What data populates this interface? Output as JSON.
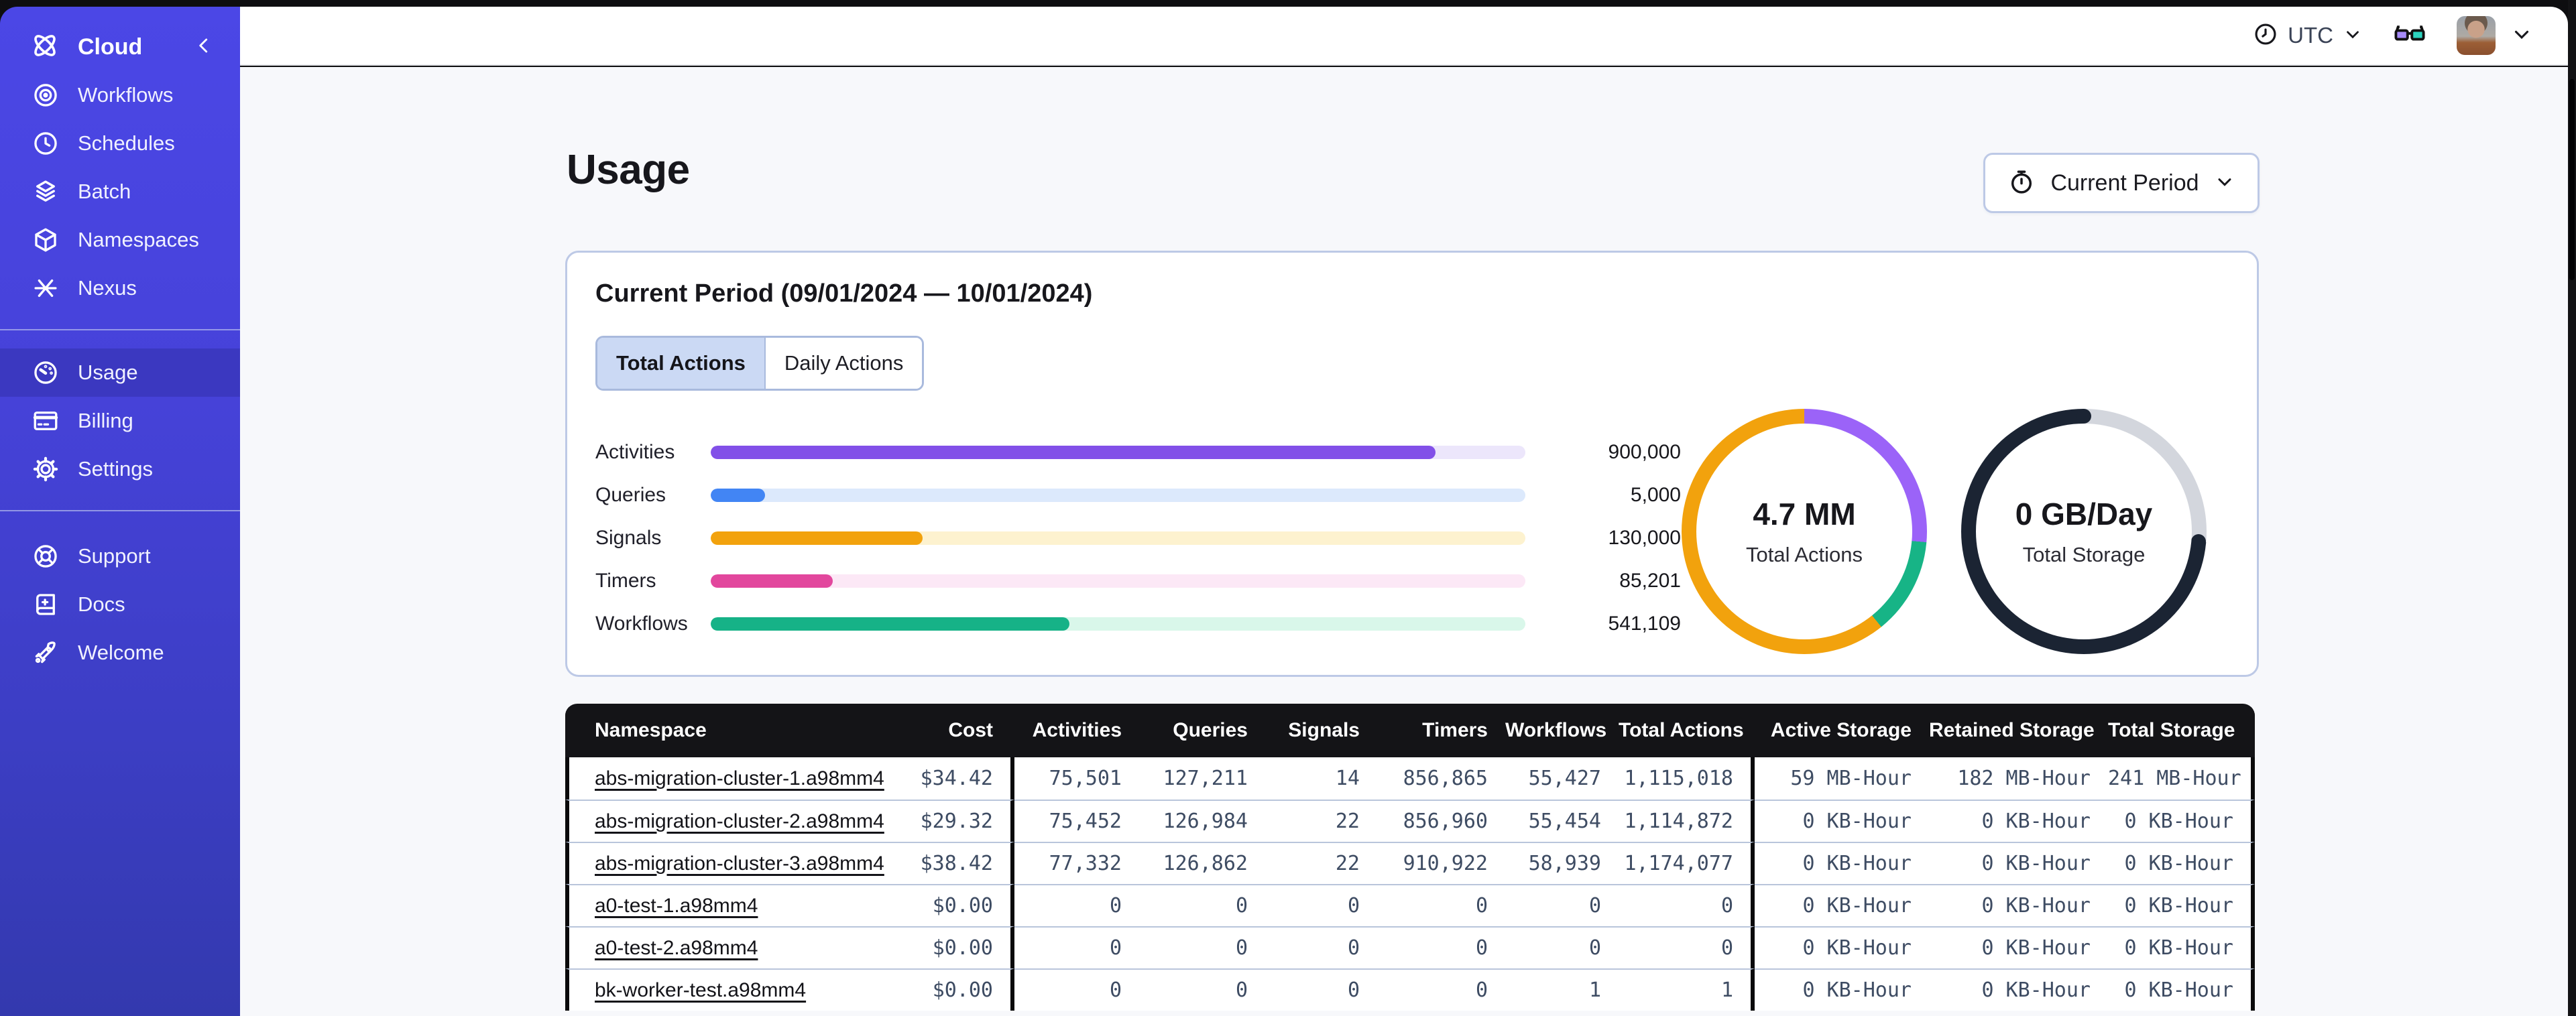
{
  "theme": {
    "sidebar_top": "#4b47e6",
    "sidebar_bottom": "#3339ae",
    "sidebar_active": "#3b38c0",
    "table_header_bg": "#141417",
    "card_border": "#bdc9e6",
    "content_bg": "#f7f8fb",
    "mono_text": "#3e4c63"
  },
  "sidebar": {
    "brand": {
      "label": "Cloud"
    },
    "groups": [
      {
        "items": [
          {
            "label": "Workflows"
          },
          {
            "label": "Schedules"
          },
          {
            "label": "Batch"
          },
          {
            "label": "Namespaces"
          },
          {
            "label": "Nexus"
          }
        ]
      },
      {
        "items": [
          {
            "label": "Usage",
            "active": true
          },
          {
            "label": "Billing"
          },
          {
            "label": "Settings"
          }
        ]
      },
      {
        "items": [
          {
            "label": "Support"
          },
          {
            "label": "Docs"
          },
          {
            "label": "Welcome"
          }
        ]
      }
    ]
  },
  "topbar": {
    "timezone": {
      "label": "UTC"
    }
  },
  "page": {
    "title": "Usage",
    "period_button": {
      "label": "Current Period"
    }
  },
  "usage_card": {
    "title": "Current Period (09/01/2024 — 10/01/2024)",
    "tabs": [
      {
        "label": "Total Actions",
        "active": true
      },
      {
        "label": "Daily Actions",
        "active": false
      }
    ]
  },
  "chart_data": [
    {
      "type": "bar",
      "orientation": "horizontal",
      "categories": [
        "Activities",
        "Queries",
        "Signals",
        "Timers",
        "Workflows"
      ],
      "values": [
        900000,
        5000,
        130000,
        85201,
        541109
      ],
      "value_labels": [
        "900,000",
        "5,000",
        "130,000",
        "85,201",
        "541,109"
      ],
      "fill_pct": [
        89,
        6.7,
        26,
        15,
        44
      ],
      "colors": [
        "#8250e8",
        "#4285f4",
        "#f2a20d",
        "#e2479d",
        "#16b287"
      ],
      "track_colors": [
        "#ece6fb",
        "#dce9fc",
        "#fdf2cf",
        "#fce8f6",
        "#d9f7ea"
      ]
    },
    {
      "type": "donut",
      "center_value": "4.7 MM",
      "center_label": "Total Actions",
      "segments": [
        {
          "color": "#9b63f8",
          "pct": 26.4
        },
        {
          "color": "#17b486",
          "pct": 12.8
        },
        {
          "color": "#f2a20d",
          "pct": 60.8
        }
      ]
    },
    {
      "type": "donut",
      "center_value": "0 GB/Day",
      "center_label": "Total Storage",
      "segments": [
        {
          "color": "#d3d6dd",
          "pct": 26.4
        },
        {
          "color": "#1b2433",
          "pct": 73.6
        }
      ]
    }
  ],
  "table": {
    "columns": [
      "Namespace",
      "Cost",
      "Activities",
      "Queries",
      "Signals",
      "Timers",
      "Workflows",
      "Total Actions",
      "Active Storage",
      "Retained Storage",
      "Total Storage"
    ],
    "rows": [
      {
        "namespace": "abs-migration-cluster-1.a98mm4",
        "cells": [
          "$34.42",
          "75,501",
          "127,211",
          "14",
          "856,865",
          "55,427",
          "1,115,018",
          "59 MB-Hour",
          "182 MB-Hour",
          "241 MB-Hour"
        ]
      },
      {
        "namespace": "abs-migration-cluster-2.a98mm4",
        "cells": [
          "$29.32",
          "75,452",
          "126,984",
          "22",
          "856,960",
          "55,454",
          "1,114,872",
          "0 KB-Hour",
          "0 KB-Hour",
          "0 KB-Hour"
        ]
      },
      {
        "namespace": "abs-migration-cluster-3.a98mm4",
        "cells": [
          "$38.42",
          "77,332",
          "126,862",
          "22",
          "910,922",
          "58,939",
          "1,174,077",
          "0 KB-Hour",
          "0 KB-Hour",
          "0 KB-Hour"
        ]
      },
      {
        "namespace": "a0-test-1.a98mm4",
        "cells": [
          "$0.00",
          "0",
          "0",
          "0",
          "0",
          "0",
          "0",
          "0 KB-Hour",
          "0 KB-Hour",
          "0 KB-Hour"
        ]
      },
      {
        "namespace": "a0-test-2.a98mm4",
        "cells": [
          "$0.00",
          "0",
          "0",
          "0",
          "0",
          "0",
          "0",
          "0 KB-Hour",
          "0 KB-Hour",
          "0 KB-Hour"
        ]
      },
      {
        "namespace": "bk-worker-test.a98mm4",
        "cells": [
          "$0.00",
          "0",
          "0",
          "0",
          "0",
          "1",
          "1",
          "0 KB-Hour",
          "0 KB-Hour",
          "0 KB-Hour"
        ]
      }
    ]
  }
}
